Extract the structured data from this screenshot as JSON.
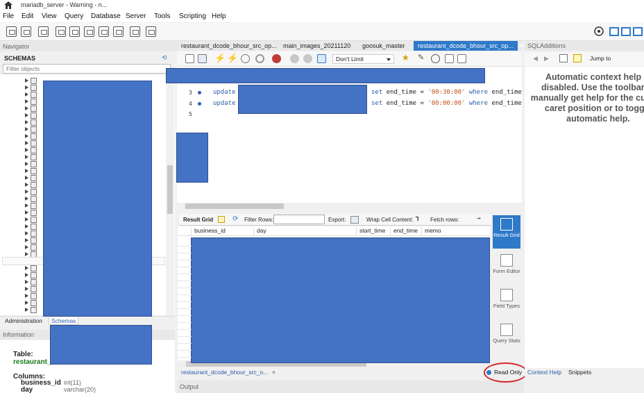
{
  "window": {
    "title": "mariadb_server - Warning - n..."
  },
  "menu": [
    "File",
    "Edit",
    "View",
    "Query",
    "Database",
    "Server",
    "Tools",
    "Scripting",
    "Help"
  ],
  "navigator": {
    "header": "Navigator",
    "schemas_label": "SCHEMAS",
    "filter_placeholder": "Filter objects",
    "tabs": [
      "Administration",
      "Schemas"
    ]
  },
  "information": {
    "header": "Information",
    "table_label": "Table:",
    "table_name": "restaurant_",
    "columns_label": "Columns:",
    "columns": [
      {
        "name": "business_id",
        "type": "int(11)"
      },
      {
        "name": "day",
        "type": "varchar(20)"
      }
    ]
  },
  "editor_tabs": [
    {
      "label": "restaurant_dcode_bhour_src_op...",
      "active": false,
      "closable": false
    },
    {
      "label": "main_images_20211120",
      "active": false,
      "closable": false
    },
    {
      "label": "goosuk_master",
      "active": false,
      "closable": false
    },
    {
      "label": "restaurant_dcode_bhour_src_op...",
      "active": true,
      "closable": true,
      "close": "×"
    }
  ],
  "sql_toolbar": {
    "limit": "Don't Limit"
  },
  "code": {
    "lines": [
      {
        "n": "3",
        "keyword": "update",
        "tail_kw1": "set",
        "tail_col1": "end_time",
        "tail_eq": "=",
        "value": "'00:30:00'",
        "tail_kw2": "where",
        "tail_col2": "end_time ="
      },
      {
        "n": "4",
        "keyword": "update",
        "tail_kw1": "set",
        "tail_col1": "end_time",
        "tail_eq": "=",
        "value": "'00:00:00'",
        "tail_kw2": "where",
        "tail_col2": "end_time ="
      },
      {
        "n": "5"
      }
    ]
  },
  "result": {
    "toolbar": {
      "result_grid": "Result Grid",
      "filter_rows": "Filter Rows:",
      "export": "Export:",
      "wrap": "Wrap Cell Content:",
      "fetch": "Fetch rows:"
    },
    "columns": [
      "business_id",
      "day",
      "start_time",
      "end_time",
      "memo"
    ],
    "side": [
      "Result Grid",
      "Form Editor",
      "Field Types",
      "Query Stats"
    ]
  },
  "bottom_tabs": {
    "query_tab": "restaurant_dcode_bhour_src_o...",
    "close": "×",
    "output": "Output"
  },
  "status": {
    "read_only": "Read Only"
  },
  "sql_additions": {
    "header": "SQLAdditions",
    "jump_to": "Jump to",
    "help_text": "Automatic context help is disabled. Use the toolbar to manually get help for the current caret position or to toggle automatic help.",
    "tabs": [
      "Context Help",
      "Snippets"
    ]
  },
  "colors": {
    "accent": "#2f79c9",
    "redaction": "#4472c4",
    "highlight_circle": "#d62525"
  }
}
